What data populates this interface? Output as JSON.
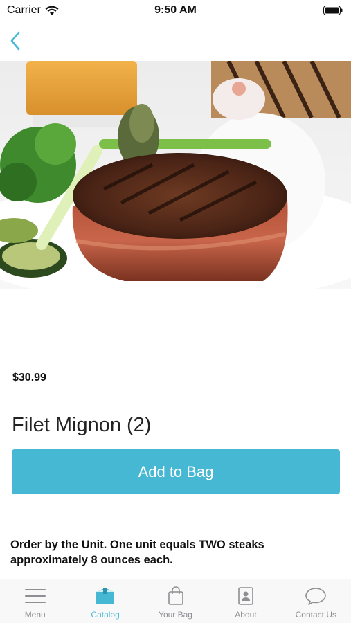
{
  "status_bar": {
    "carrier": "Carrier",
    "time": "9:50 AM"
  },
  "nav": {
    "back_icon": "chevron-left-icon"
  },
  "product": {
    "price": "$30.99",
    "title": "Filet Mignon (2)",
    "add_button_label": "Add to Bag",
    "description": "Order by the Unit.  One unit equals TWO steaks approximately 8 ounces each."
  },
  "tab_bar": {
    "items": [
      {
        "label": "Menu",
        "icon": "hamburger-menu-icon",
        "active": false
      },
      {
        "label": "Catalog",
        "icon": "box-icon",
        "active": true
      },
      {
        "label": "Your Bag",
        "icon": "shopping-bag-icon",
        "active": false
      },
      {
        "label": "About",
        "icon": "contact-card-icon",
        "active": false
      },
      {
        "label": "Contact Us",
        "icon": "speech-bubble-icon",
        "active": false
      }
    ]
  },
  "colors": {
    "accent": "#47b8d3",
    "inactive_tab": "#8e8e93"
  }
}
